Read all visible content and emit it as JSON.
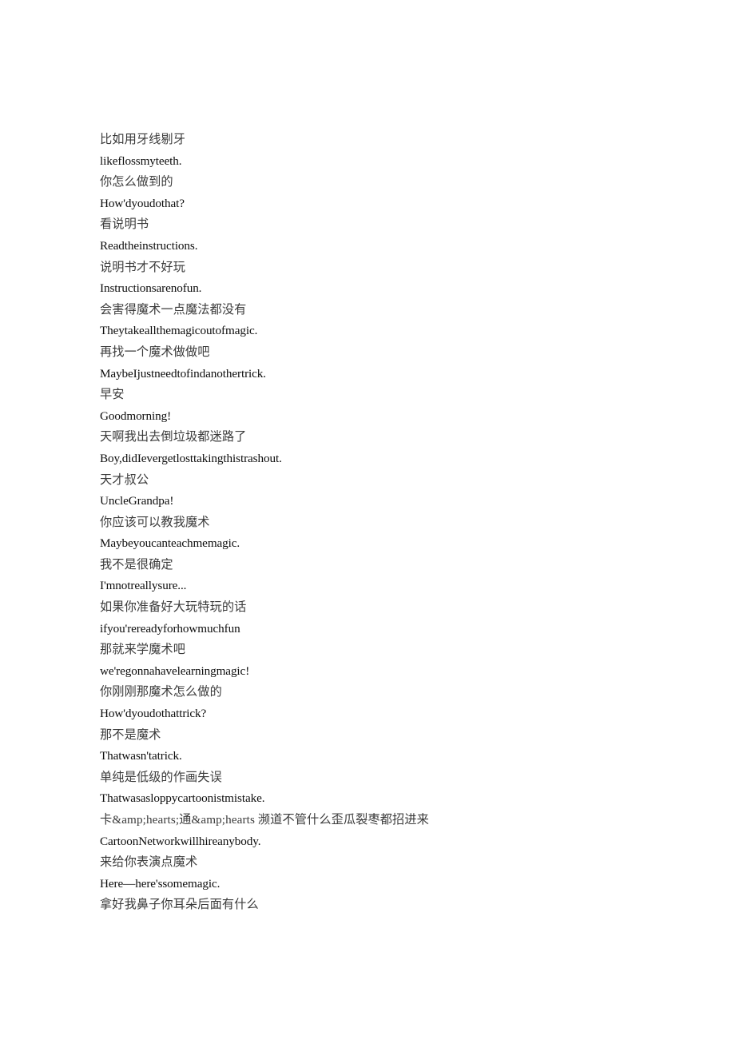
{
  "document": {
    "page_background": "#ffffff",
    "zh_text_color": "#3b3b3b",
    "en_text_color": "#0d0d0d",
    "lines": [
      {
        "lang": "zh",
        "text": "比如用牙线剔牙"
      },
      {
        "lang": "en",
        "text": "likeflossmyteeth."
      },
      {
        "lang": "zh",
        "text": "你怎么做到的"
      },
      {
        "lang": "en",
        "text": "How'dyoudothat?"
      },
      {
        "lang": "zh",
        "text": "看说明书"
      },
      {
        "lang": "en",
        "text": "Readtheinstructions."
      },
      {
        "lang": "zh",
        "text": "说明书才不好玩"
      },
      {
        "lang": "en",
        "text": "Instructionsarenofun."
      },
      {
        "lang": "zh",
        "text": "会害得魔术一点魔法都没有"
      },
      {
        "lang": "en",
        "text": "Theytakeallthemagicoutofmagic."
      },
      {
        "lang": "zh",
        "text": "再找一个魔术做做吧"
      },
      {
        "lang": "en",
        "text": "MaybeIjustneedtofindanothertrick."
      },
      {
        "lang": "zh",
        "text": "早安"
      },
      {
        "lang": "en",
        "text": "Goodmorning!"
      },
      {
        "lang": "zh",
        "text": "天啊我出去倒垃圾都迷路了"
      },
      {
        "lang": "en",
        "text": "Boy,didIevergetlosttakingthistrashout."
      },
      {
        "lang": "zh",
        "text": "天才叔公"
      },
      {
        "lang": "en",
        "text": "UncleGrandpa!"
      },
      {
        "lang": "zh",
        "text": "你应该可以教我魔术"
      },
      {
        "lang": "en",
        "text": "Maybeyoucanteachmemagic."
      },
      {
        "lang": "zh",
        "text": "我不是很确定"
      },
      {
        "lang": "en",
        "text": "I'mnotreallysure..."
      },
      {
        "lang": "zh",
        "text": "如果你准备好大玩特玩的话"
      },
      {
        "lang": "en",
        "text": "ifyou'rereadyforhowmuchfun"
      },
      {
        "lang": "zh",
        "text": "那就来学魔术吧"
      },
      {
        "lang": "en",
        "text": "we'regonnahavelearningmagic!"
      },
      {
        "lang": "zh",
        "text": "你刚刚那魔术怎么做的"
      },
      {
        "lang": "en",
        "text": "How'dyoudothattrick?"
      },
      {
        "lang": "zh",
        "text": "那不是魔术"
      },
      {
        "lang": "en",
        "text": "Thatwasn'tatrick."
      },
      {
        "lang": "zh",
        "text": "单纯是低级的作画失误"
      },
      {
        "lang": "en",
        "text": "Thatwasasloppycartoonistmistake."
      },
      {
        "lang": "zh",
        "text": "卡&amp;hearts;通&amp;hearts 濒道不管什么歪瓜裂枣都招进来"
      },
      {
        "lang": "en",
        "text": "CartoonNetworkwillhireanybody."
      },
      {
        "lang": "zh",
        "text": "来给你表演点魔术"
      },
      {
        "lang": "en",
        "text": "Here—here'ssomemagic."
      },
      {
        "lang": "zh",
        "text": "拿好我鼻子你耳朵后面有什么"
      }
    ]
  }
}
